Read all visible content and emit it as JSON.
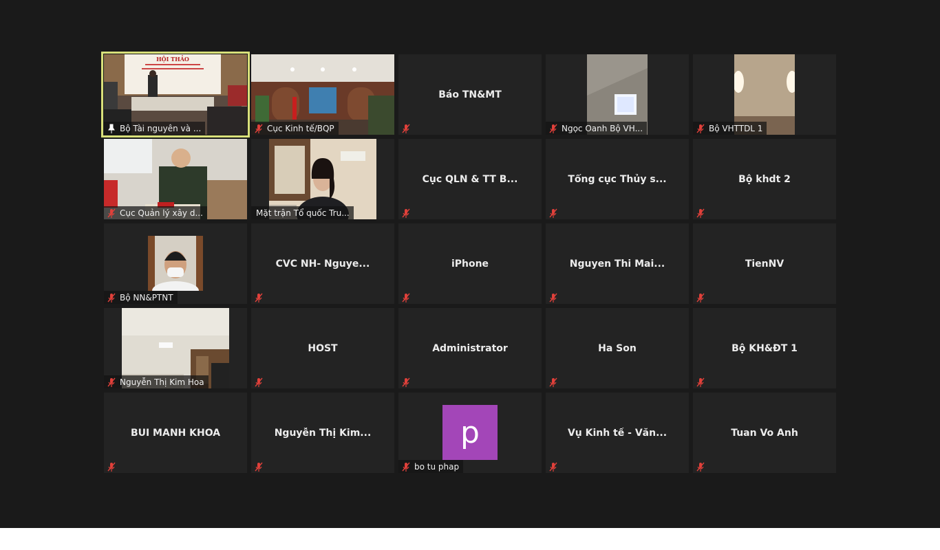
{
  "meeting": {
    "participants": [
      {
        "name": "Bộ Tài nguyên và ...",
        "video": "conference",
        "active": true,
        "pinned": true
      },
      {
        "name": "Cục Kinh tế/BQP",
        "video": "officeroom",
        "muted": true
      },
      {
        "name": "Báo TN&MT",
        "title": "Báo TN&MT",
        "muted": true
      },
      {
        "name": "Ngọc Oanh Bộ VH...",
        "video": "ceiling",
        "muted": true
      },
      {
        "name": "Bộ VHTTDL 1",
        "video": "wall",
        "muted": true
      },
      {
        "name": "Cục Quản lý xây d...",
        "video": "officer",
        "muted": true
      },
      {
        "name": "Mặt trận Tổ quốc Tru...",
        "video": "woman",
        "muted": true
      },
      {
        "name": "",
        "title": "Cục QLN & TT B...",
        "muted": true
      },
      {
        "name": "",
        "title": "Tổng cục Thủy s...",
        "muted": true
      },
      {
        "name": "",
        "title": "Bộ khdt 2",
        "muted": true
      },
      {
        "name": "Bộ NN&PTNT",
        "video": "mask",
        "muted": true
      },
      {
        "name": "",
        "title": "CVC NH- Nguye...",
        "muted": true
      },
      {
        "name": "",
        "title": "iPhone",
        "muted": true
      },
      {
        "name": "",
        "title": "Nguyen Thi Mai...",
        "muted": true
      },
      {
        "name": "",
        "title": "TienNV",
        "muted": true
      },
      {
        "name": "Nguyễn Thị Kim Hoa",
        "video": "room",
        "muted": true
      },
      {
        "name": "",
        "title": "HOST",
        "muted": true
      },
      {
        "name": "",
        "title": "Administrator",
        "muted": true
      },
      {
        "name": "",
        "title": "Ha Son",
        "muted": true
      },
      {
        "name": "",
        "title": "Bộ KH&ĐT 1",
        "muted": true
      },
      {
        "name": "",
        "title": "BUI MANH KHOA",
        "muted": true
      },
      {
        "name": "",
        "title": "Nguyễn Thị Kim...",
        "muted": true
      },
      {
        "name": "bo tu phap",
        "avatar": "p",
        "muted": true
      },
      {
        "name": "",
        "title": "Vụ Kinh tế - Văn...",
        "muted": true
      },
      {
        "name": "",
        "title": "Tuan Vo Anh",
        "muted": true
      }
    ]
  },
  "conference_banner": {
    "line1": "HỘI THẢO"
  },
  "colors": {
    "background": "#1a1a1a",
    "tile": "#232323",
    "active_border": "#d9e07a",
    "avatar": "#a346b8",
    "mute_red": "#e0403a"
  }
}
